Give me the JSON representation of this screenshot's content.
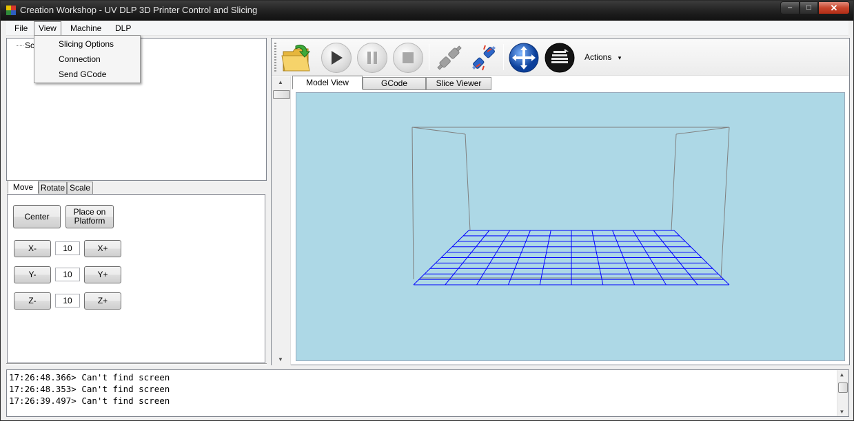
{
  "window": {
    "title": "Creation Workshop - UV DLP 3D Printer Control and Slicing",
    "min_glyph": "–",
    "max_glyph": "□",
    "close_glyph": "✕"
  },
  "menu": {
    "items": [
      "File",
      "View",
      "Machine",
      "DLP"
    ],
    "open_index": 1,
    "view_dropdown": [
      "Slicing Options",
      "Connection",
      "Send GCode"
    ]
  },
  "scene_tree": {
    "root_label": "Sc"
  },
  "transform_tabs": [
    "Move",
    "Rotate",
    "Scale"
  ],
  "move_panel": {
    "center_label": "Center",
    "place_label_line1": "Place on",
    "place_label_line2": "Platform",
    "x_minus": "X-",
    "x_plus": "X+",
    "x_value": "10",
    "y_minus": "Y-",
    "y_plus": "Y+",
    "y_value": "10",
    "z_minus": "Z-",
    "z_plus": "Z+",
    "z_value": "10"
  },
  "toolbar": {
    "icons": [
      "open-folder-icon",
      "play-icon",
      "pause-icon",
      "stop-icon",
      "disconnect-icon",
      "connect-icon",
      "move-view-icon",
      "slice-icon"
    ],
    "actions_label": "Actions",
    "actions_arrow": "▾"
  },
  "view_tabs": [
    "Model View",
    "GCode",
    "Slice Viewer"
  ],
  "viewport": {
    "background": "#add8e6",
    "grid_color": "#0000ff",
    "box_color": "#808080"
  },
  "log": {
    "lines": [
      "17:26:48.366> Can't find screen",
      "17:26:48.353> Can't find screen",
      "17:26:39.497> Can't find screen"
    ]
  }
}
